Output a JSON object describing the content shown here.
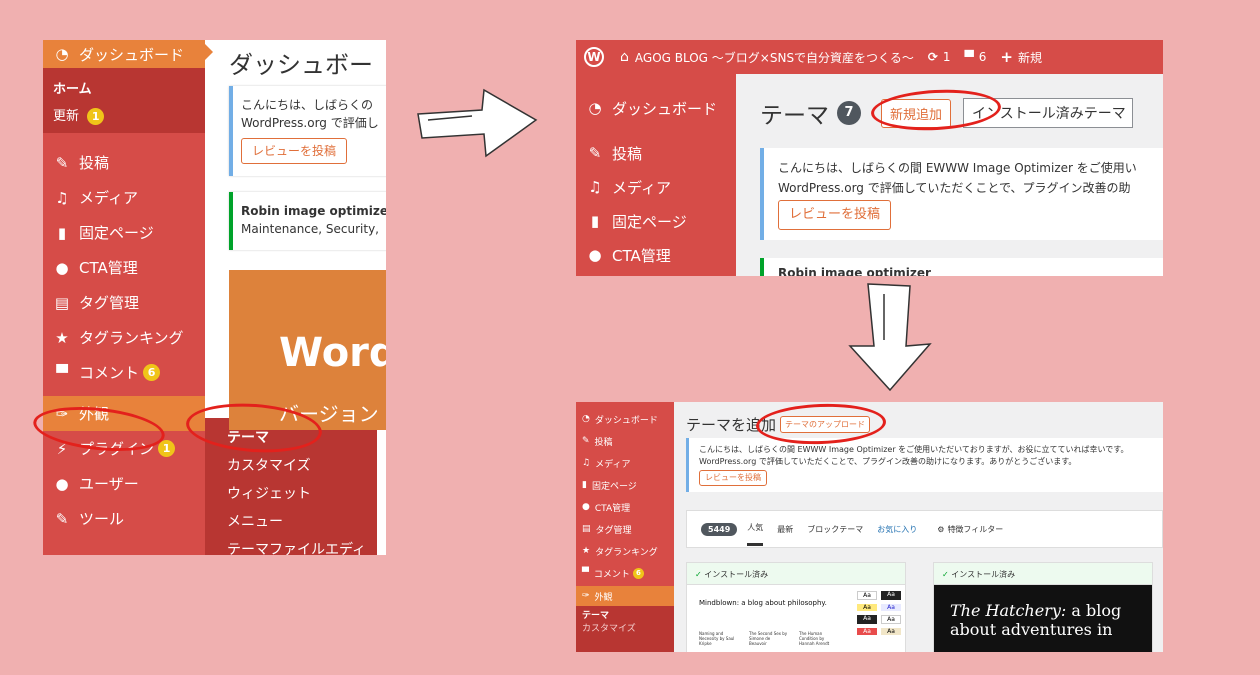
{
  "p1": {
    "dashboard": "ダッシュボード",
    "home": "ホーム",
    "update": "更新",
    "update_count": "1",
    "menu": [
      {
        "icon": "✎",
        "label": "投稿",
        "name": "posts"
      },
      {
        "icon": "♫",
        "label": "メディア",
        "name": "media"
      },
      {
        "icon": "▮",
        "label": "固定ページ",
        "name": "pages"
      },
      {
        "icon": "●",
        "label": "CTA管理",
        "name": "cta"
      },
      {
        "icon": "▤",
        "label": "タグ管理",
        "name": "tags"
      },
      {
        "icon": "★",
        "label": "タグランキング",
        "name": "tag-ranking"
      }
    ],
    "comments": "コメント",
    "comments_count": "6",
    "appearance": "外観",
    "plugins": "プラグイン",
    "plugins_count": "1",
    "users": "ユーザー",
    "tools": "ツール",
    "submenu": [
      "テーマ",
      "カスタマイズ",
      "ウィジェット",
      "メニュー",
      "テーマファイルエディ"
    ],
    "title": "ダッシュボー",
    "notice1_line1": "こんにちは、しばらくの",
    "notice1_line2": "WordPress.org で評価し",
    "review_btn": "レビューを投稿",
    "notice2_line1": "Robin image optimizer",
    "notice2_line2": "Maintenance, Security,",
    "hero_title": "Word",
    "hero_sub": "バージョン"
  },
  "p2": {
    "site_title": "AGOG BLOG ～ブログ×SNSで自分資産をつくる～",
    "updates": "1",
    "comments": "6",
    "new": "新規",
    "dashboard": "ダッシュボード",
    "menu": [
      "投稿",
      "メディア",
      "固定ページ",
      "CTA管理"
    ],
    "page_title": "テーマ",
    "theme_count": "7",
    "add_new": "新規追加",
    "search_placeholder": "インストール済みテーマ",
    "notice_line1": "こんにちは、しばらくの間 EWWW Image Optimizer をご使用い",
    "notice_line2": "WordPress.org で評価していただくことで、プラグイン改善の助",
    "review_btn": "レビューを投稿",
    "cut_text": "Robin image optimizer"
  },
  "p3": {
    "menu": [
      "ダッシュボード",
      "投稿",
      "メディア",
      "固定ページ",
      "CTA管理",
      "タグ管理",
      "タグランキング",
      "コメント"
    ],
    "comments_count": "6",
    "appearance": "外観",
    "sub": [
      "テーマ",
      "カスタマイズ"
    ],
    "page_title": "テーマを追加",
    "upload_btn": "テーマのアップロード",
    "notice_line1": "こんにちは、しばらくの間 EWWW Image Optimizer をご使用いただいておりますが、お役に立てていれば幸いです。",
    "notice_line2": "WordPress.org で評価していただくことで、プラグイン改善の助けになります。ありがとうございます。",
    "review_btn": "レビューを投稿",
    "count": "5449",
    "tabs": [
      "人気",
      "最新",
      "ブロックテーマ",
      "お気に入り"
    ],
    "filter": "特徴フィルター",
    "installed": "インストール済み",
    "card1_title": "Mindblown: a blog about philosophy.",
    "card1_books": [
      "Naming and Necessity by Saul Kripke",
      "The Second Sex by Simone de Beauvoir",
      "The Human Condition by Hannah Arendt"
    ],
    "card2_title_italic": "The Hatchery:",
    "card2_title_rest": " a blog about adventures in"
  },
  "colors": {
    "bg": "#f0b0b0",
    "wp_red": "#d64c48",
    "wp_dark": "#b83632",
    "accent_orange": "#e06f3a",
    "circle": "#e3211c"
  }
}
